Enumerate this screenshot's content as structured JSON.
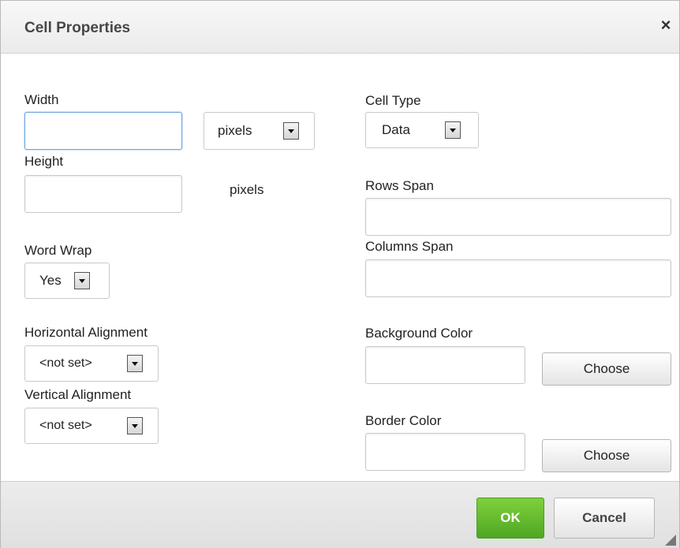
{
  "dialog": {
    "title": "Cell Properties",
    "close_glyph": "×"
  },
  "left": {
    "width_label": "Width",
    "width_value": "",
    "width_unit": "pixels",
    "height_label": "Height",
    "height_value": "",
    "height_unit": "pixels",
    "wordwrap_label": "Word Wrap",
    "wordwrap_value": "Yes",
    "halign_label": "Horizontal Alignment",
    "halign_value": "<not set>",
    "valign_label": "Vertical Alignment",
    "valign_value": "<not set>"
  },
  "right": {
    "celltype_label": "Cell Type",
    "celltype_value": "Data",
    "rowspan_label": "Rows Span",
    "rowspan_value": "",
    "colspan_label": "Columns Span",
    "colspan_value": "",
    "bgcolor_label": "Background Color",
    "bgcolor_value": "",
    "bgcolor_button": "Choose",
    "bordercolor_label": "Border Color",
    "bordercolor_value": "",
    "bordercolor_button": "Choose"
  },
  "footer": {
    "ok_label": "OK",
    "cancel_label": "Cancel"
  },
  "colors": {
    "ok_green": "#5cb82c",
    "focus_blue": "#6fa4de"
  },
  "icons": {
    "close": "close-icon",
    "dropdown": "chevron-down-icon",
    "resize": "resize-grip-icon"
  }
}
